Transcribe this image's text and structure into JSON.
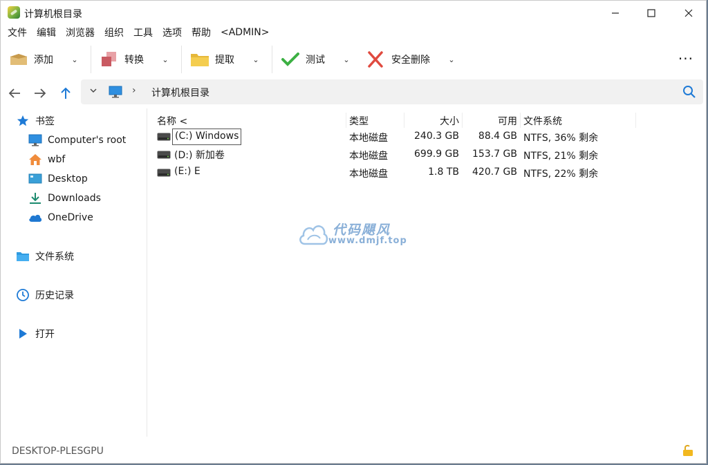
{
  "window": {
    "title": "计算机根目录"
  },
  "menu": [
    "文件",
    "编辑",
    "浏览器",
    "组织",
    "工具",
    "选项",
    "帮助",
    "<ADMIN>"
  ],
  "toolbar": {
    "add": "添加",
    "convert": "转换",
    "extract": "提取",
    "test": "测试",
    "delete": "安全删除",
    "more": "···"
  },
  "address": {
    "path": "计算机根目录"
  },
  "sidebar": {
    "bookmarks": "书签",
    "items": [
      "Computer's root",
      "wbf",
      "Desktop",
      "Downloads",
      "OneDrive"
    ],
    "filesystem": "文件系统",
    "history": "历史记录",
    "open": "打开"
  },
  "columns": {
    "name": "名称 <",
    "type": "类型",
    "size": "大小",
    "free": "可用",
    "fs": "文件系统"
  },
  "drives": [
    {
      "name": "(C:) Windows",
      "type": "本地磁盘",
      "size": "240.3 GB",
      "free": "88.4 GB",
      "fs": "NTFS, 36% 剩余"
    },
    {
      "name": "(D:) 新加卷",
      "type": "本地磁盘",
      "size": "699.9 GB",
      "free": "153.7 GB",
      "fs": "NTFS, 21% 剩余"
    },
    {
      "name": "(E:) E",
      "type": "本地磁盘",
      "size": "1.8 TB",
      "free": "420.7 GB",
      "fs": "NTFS, 22% 剩余"
    }
  ],
  "watermark": {
    "cn": "代码飓风",
    "url": "www.dmjf.top"
  },
  "status": {
    "computer": "DESKTOP-PLESGPU"
  }
}
